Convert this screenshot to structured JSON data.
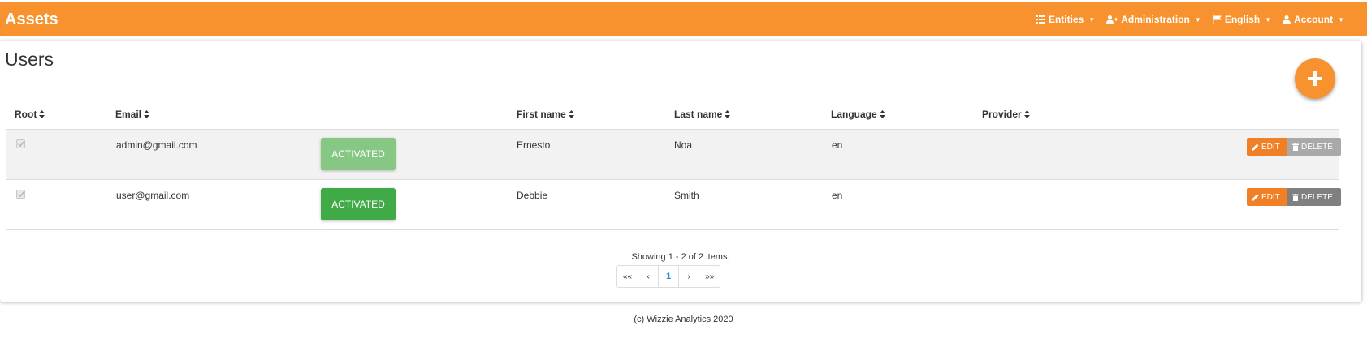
{
  "app": {
    "title": "Assets"
  },
  "nav": {
    "entities": "Entities",
    "administration": "Administration",
    "language": "English",
    "account": "Account"
  },
  "page": {
    "title": "Users"
  },
  "table": {
    "headers": {
      "root": "Root",
      "email": "Email",
      "first_name": "First name",
      "last_name": "Last name",
      "language": "Language",
      "provider": "Provider"
    },
    "rows": [
      {
        "root_checked": true,
        "email": "admin@gmail.com",
        "status": "ACTIVATED",
        "first_name": "Ernesto",
        "last_name": "Noa",
        "language": "en",
        "provider": ""
      },
      {
        "root_checked": true,
        "email": "user@gmail.com",
        "status": "ACTIVATED",
        "first_name": "Debbie",
        "last_name": "Smith",
        "language": "en",
        "provider": ""
      }
    ],
    "edit_label": "EDIT",
    "delete_label": "DELETE"
  },
  "pagination": {
    "summary": "Showing 1 - 2 of 2 items.",
    "first": "««",
    "prev": "‹",
    "current": "1",
    "next": "›",
    "last": "»»"
  },
  "footer": {
    "text": "(c) Wizzie Analytics 2020"
  },
  "colors": {
    "brand": "#f7922f",
    "activated_light": "#86c784",
    "activated_dark": "#3faa46",
    "link": "#2a8be0"
  },
  "icons": {
    "entities": "list-icon",
    "administration": "user-plus-icon",
    "language": "flag-icon",
    "account": "user-icon",
    "add": "plus-icon",
    "edit": "pencil-icon",
    "delete": "trash-icon",
    "sort": "sort-icon"
  }
}
